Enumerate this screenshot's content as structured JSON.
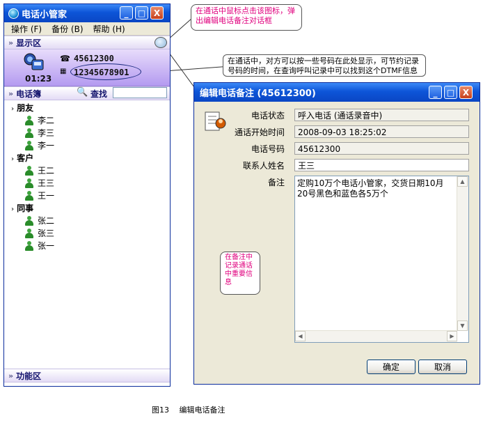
{
  "main_window": {
    "title": "电话小管家",
    "controls": {
      "minimize": "_",
      "maximize": "□",
      "close": "X"
    },
    "menu": [
      "操作 (F)",
      "备份 (B)",
      "帮助 (H)"
    ],
    "display_section": {
      "label": "显示区",
      "chevron": "»"
    },
    "call": {
      "incoming_number": "45612300",
      "dtmf_number": "12345678901",
      "duration": "01:23"
    },
    "phonebook": {
      "label": "电话簿",
      "search_label": "查找",
      "search_value": ""
    },
    "groups": [
      {
        "name": "朋友",
        "members": [
          "李二",
          "李三",
          "李一"
        ]
      },
      {
        "name": "客户",
        "members": [
          "王二",
          "王三",
          "王一"
        ]
      },
      {
        "name": "同事",
        "members": [
          "张二",
          "张三",
          "张一"
        ]
      }
    ],
    "function_section": {
      "label": "功能区"
    }
  },
  "dialog": {
    "title": "编辑电话备注 (45612300)",
    "fields": {
      "status_label": "电话状态",
      "status_value": "呼入电话 (通话录音中)",
      "start_label": "通话开始时间",
      "start_value": "2008-09-03 18:25:02",
      "number_label": "电话号码",
      "number_value": "45612300",
      "contact_label": "联系人姓名",
      "contact_value": "王三",
      "notes_label": "备注",
      "notes_value": "定购10万个电话小管家，交货日期10月20号黑色和蓝色各5万个"
    },
    "ok_label": "确定",
    "cancel_label": "取消"
  },
  "callouts": {
    "icon_tip": "在通话中鼠标点击该图标，弹出编辑电话备注对话框",
    "dtmf_tip": "在通话中，对方可以按一些号码在此处显示，可节约记录号码的时间，在查询呼叫记录中可以找到这个DTMF信息",
    "notes_tip": "在备注中记录通话中重要信息"
  },
  "caption": "图13　 编辑电话备注",
  "colors": {
    "title_blue": "#0d55d8",
    "callout_pink": "#e0007e",
    "call_area_purple": "#b49af0"
  }
}
